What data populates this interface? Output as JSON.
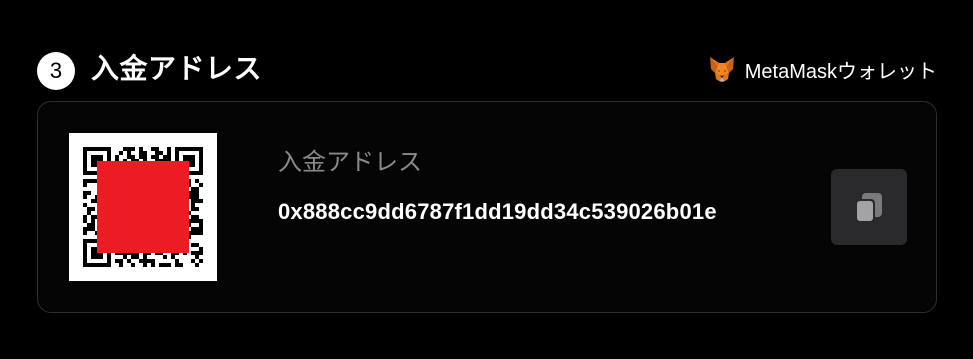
{
  "section": {
    "step": "3",
    "title": "入金アドレス"
  },
  "wallet": {
    "name": "MetaMaskウォレット",
    "icon": "metamask-fox-icon"
  },
  "deposit": {
    "label": "入金アドレス",
    "address": "0x888cc9dd6787f1dd19dd34c539026b01e",
    "copy_icon": "copy-icon"
  },
  "colors": {
    "background": "#000000",
    "card_border": "#2e2e2e",
    "label_gray": "#8a8a8a",
    "copy_button": "#2a2a2c",
    "qr_overlay": "#ed1c24"
  }
}
